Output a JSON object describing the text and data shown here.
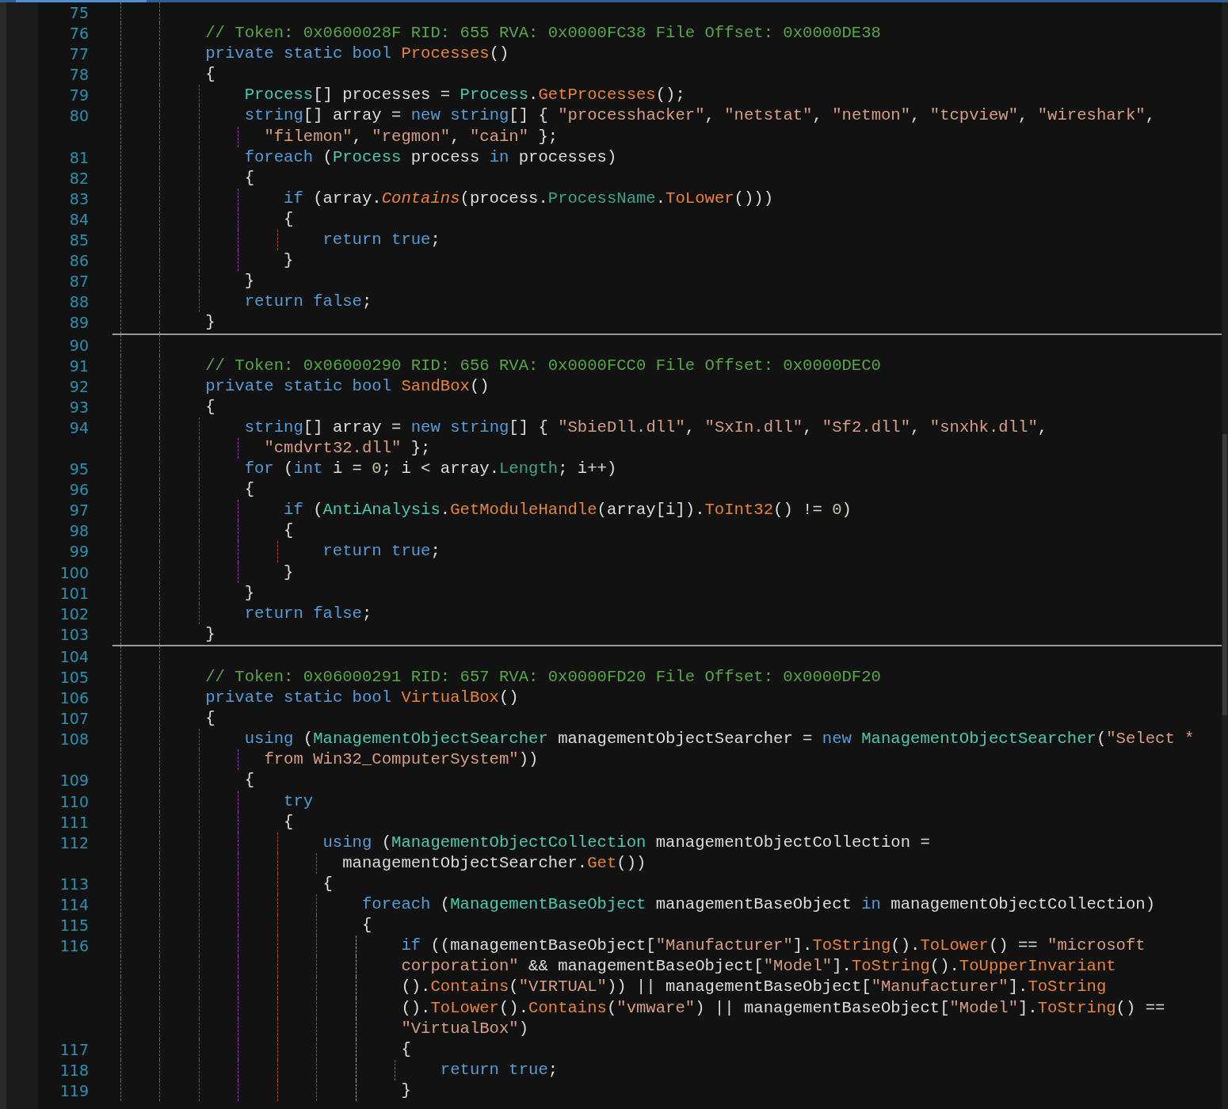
{
  "editor": {
    "blocks": [
      {
        "rows": [
          {
            "number": "75"
          },
          {
            "number": "76",
            "tokens": [
              {
                "kind": "comment",
                "text": "        // Token: 0x0600028F RID: 655 RVA: 0x0000FC38 File Offset: 0x0000DE38"
              }
            ]
          },
          {
            "number": "77",
            "tokens": [
              {
                "kind": "keyword",
                "text": "        private static bool "
              },
              {
                "kind": "method",
                "text": "Processes"
              },
              {
                "kind": "plain",
                "text": "()"
              }
            ]
          },
          {
            "number": "78",
            "tokens": [
              {
                "kind": "plain",
                "text": "        {"
              }
            ]
          },
          {
            "number": "79",
            "tokens": [
              {
                "kind": "type",
                "text": "            Process"
              },
              {
                "kind": "plain",
                "text": "[] processes = "
              },
              {
                "kind": "type",
                "text": "Process"
              },
              {
                "kind": "plain",
                "text": "."
              },
              {
                "kind": "method",
                "text": "GetProcesses"
              },
              {
                "kind": "plain",
                "text": "();"
              }
            ]
          },
          {
            "number": "80",
            "tokens": [
              {
                "kind": "keyword",
                "text": "            string"
              },
              {
                "kind": "plain",
                "text": "[] array = "
              },
              {
                "kind": "keyword",
                "text": "new string"
              },
              {
                "kind": "plain",
                "text": "[] { "
              },
              {
                "kind": "string",
                "text": "\"processhacker\""
              },
              {
                "kind": "plain",
                "text": ", "
              },
              {
                "kind": "string",
                "text": "\"netstat\""
              },
              {
                "kind": "plain",
                "text": ", "
              },
              {
                "kind": "string",
                "text": "\"netmon\""
              },
              {
                "kind": "plain",
                "text": ", "
              },
              {
                "kind": "string",
                "text": "\"tcpview\""
              },
              {
                "kind": "plain",
                "text": ", "
              },
              {
                "kind": "string",
                "text": "\"wireshark\""
              },
              {
                "kind": "plain",
                "text": ","
              }
            ]
          },
          {
            "tokens": [
              {
                "kind": "string",
                "text": "              \"filemon\""
              },
              {
                "kind": "plain",
                "text": ", "
              },
              {
                "kind": "string",
                "text": "\"regmon\""
              },
              {
                "kind": "plain",
                "text": ", "
              },
              {
                "kind": "string",
                "text": "\"cain\""
              },
              {
                "kind": "plain",
                "text": " };"
              }
            ]
          },
          {
            "number": "81",
            "tokens": [
              {
                "kind": "keyword",
                "text": "            foreach"
              },
              {
                "kind": "plain",
                "text": " ("
              },
              {
                "kind": "type",
                "text": "Process"
              },
              {
                "kind": "plain",
                "text": " process "
              },
              {
                "kind": "keyword",
                "text": "in"
              },
              {
                "kind": "plain",
                "text": " processes)"
              }
            ]
          },
          {
            "number": "82",
            "tokens": [
              {
                "kind": "plain",
                "text": "            {"
              }
            ]
          },
          {
            "number": "83",
            "tokens": [
              {
                "kind": "keyword",
                "text": "                if"
              },
              {
                "kind": "plain",
                "text": " (array."
              },
              {
                "kind": "extension",
                "text": "Contains"
              },
              {
                "kind": "plain",
                "text": "(process."
              },
              {
                "kind": "property",
                "text": "ProcessName"
              },
              {
                "kind": "plain",
                "text": "."
              },
              {
                "kind": "method",
                "text": "ToLower"
              },
              {
                "kind": "plain",
                "text": "()))"
              }
            ]
          },
          {
            "number": "84",
            "tokens": [
              {
                "kind": "plain",
                "text": "                {"
              }
            ]
          },
          {
            "number": "85",
            "tokens": [
              {
                "kind": "keyword",
                "text": "                    return true"
              },
              {
                "kind": "plain",
                "text": ";"
              }
            ]
          },
          {
            "number": "86",
            "tokens": [
              {
                "kind": "plain",
                "text": "                }"
              }
            ]
          },
          {
            "number": "87",
            "tokens": [
              {
                "kind": "plain",
                "text": "            }"
              }
            ]
          },
          {
            "number": "88",
            "tokens": [
              {
                "kind": "keyword",
                "text": "            return false"
              },
              {
                "kind": "plain",
                "text": ";"
              }
            ]
          },
          {
            "number": "89",
            "tokens": [
              {
                "kind": "plain",
                "text": "        }"
              }
            ]
          }
        ]
      },
      {
        "rows": [
          {
            "number": "90"
          },
          {
            "number": "91",
            "tokens": [
              {
                "kind": "comment",
                "text": "        // Token: 0x06000290 RID: 656 RVA: 0x0000FCC0 File Offset: 0x0000DEC0"
              }
            ]
          },
          {
            "number": "92",
            "tokens": [
              {
                "kind": "keyword",
                "text": "        private static bool "
              },
              {
                "kind": "method",
                "text": "SandBox"
              },
              {
                "kind": "plain",
                "text": "()"
              }
            ]
          },
          {
            "number": "93",
            "tokens": [
              {
                "kind": "plain",
                "text": "        {"
              }
            ]
          },
          {
            "number": "94",
            "tokens": [
              {
                "kind": "keyword",
                "text": "            string"
              },
              {
                "kind": "plain",
                "text": "[] array = "
              },
              {
                "kind": "keyword",
                "text": "new string"
              },
              {
                "kind": "plain",
                "text": "[] { "
              },
              {
                "kind": "string",
                "text": "\"SbieDll.dll\""
              },
              {
                "kind": "plain",
                "text": ", "
              },
              {
                "kind": "string",
                "text": "\"SxIn.dll\""
              },
              {
                "kind": "plain",
                "text": ", "
              },
              {
                "kind": "string",
                "text": "\"Sf2.dll\""
              },
              {
                "kind": "plain",
                "text": ", "
              },
              {
                "kind": "string",
                "text": "\"snxhk.dll\""
              },
              {
                "kind": "plain",
                "text": ","
              }
            ]
          },
          {
            "tokens": [
              {
                "kind": "string",
                "text": "              \"cmdvrt32.dll\""
              },
              {
                "kind": "plain",
                "text": " };"
              }
            ]
          },
          {
            "number": "95",
            "tokens": [
              {
                "kind": "keyword",
                "text": "            for"
              },
              {
                "kind": "plain",
                "text": " ("
              },
              {
                "kind": "keyword",
                "text": "int"
              },
              {
                "kind": "plain",
                "text": " i = "
              },
              {
                "kind": "number",
                "text": "0"
              },
              {
                "kind": "plain",
                "text": "; i < array."
              },
              {
                "kind": "property",
                "text": "Length"
              },
              {
                "kind": "plain",
                "text": "; i++)"
              }
            ]
          },
          {
            "number": "96",
            "tokens": [
              {
                "kind": "plain",
                "text": "            {"
              }
            ]
          },
          {
            "number": "97",
            "tokens": [
              {
                "kind": "keyword",
                "text": "                if"
              },
              {
                "kind": "plain",
                "text": " ("
              },
              {
                "kind": "type",
                "text": "AntiAnalysis"
              },
              {
                "kind": "plain",
                "text": "."
              },
              {
                "kind": "method",
                "text": "GetModuleHandle"
              },
              {
                "kind": "plain",
                "text": "(array[i])."
              },
              {
                "kind": "method",
                "text": "ToInt32"
              },
              {
                "kind": "plain",
                "text": "() != "
              },
              {
                "kind": "number",
                "text": "0"
              },
              {
                "kind": "plain",
                "text": ")"
              }
            ]
          },
          {
            "number": "98",
            "tokens": [
              {
                "kind": "plain",
                "text": "                {"
              }
            ]
          },
          {
            "number": "99",
            "tokens": [
              {
                "kind": "keyword",
                "text": "                    return true"
              },
              {
                "kind": "plain",
                "text": ";"
              }
            ]
          },
          {
            "number": "100",
            "tokens": [
              {
                "kind": "plain",
                "text": "                }"
              }
            ]
          },
          {
            "number": "101",
            "tokens": [
              {
                "kind": "plain",
                "text": "            }"
              }
            ]
          },
          {
            "number": "102",
            "tokens": [
              {
                "kind": "keyword",
                "text": "            return false"
              },
              {
                "kind": "plain",
                "text": ";"
              }
            ]
          },
          {
            "number": "103",
            "tokens": [
              {
                "kind": "plain",
                "text": "        }"
              }
            ]
          }
        ]
      },
      {
        "rows": [
          {
            "number": "104"
          },
          {
            "number": "105",
            "tokens": [
              {
                "kind": "comment",
                "text": "        // Token: 0x06000291 RID: 657 RVA: 0x0000FD20 File Offset: 0x0000DF20"
              }
            ]
          },
          {
            "number": "106",
            "tokens": [
              {
                "kind": "keyword",
                "text": "        private static bool "
              },
              {
                "kind": "method",
                "text": "VirtualBox"
              },
              {
                "kind": "plain",
                "text": "()"
              }
            ]
          },
          {
            "number": "107",
            "tokens": [
              {
                "kind": "plain",
                "text": "        {"
              }
            ]
          },
          {
            "number": "108",
            "tokens": [
              {
                "kind": "keyword",
                "text": "            using"
              },
              {
                "kind": "plain",
                "text": " ("
              },
              {
                "kind": "type",
                "text": "ManagementObjectSearcher"
              },
              {
                "kind": "plain",
                "text": " managementObjectSearcher = "
              },
              {
                "kind": "keyword",
                "text": "new "
              },
              {
                "kind": "type",
                "text": "ManagementObjectSearcher"
              },
              {
                "kind": "plain",
                "text": "("
              },
              {
                "kind": "string",
                "text": "\"Select *"
              }
            ]
          },
          {
            "tokens": [
              {
                "kind": "string",
                "text": "              from Win32_ComputerSystem\""
              },
              {
                "kind": "plain",
                "text": "))"
              }
            ]
          },
          {
            "number": "109",
            "tokens": [
              {
                "kind": "plain",
                "text": "            {"
              }
            ]
          },
          {
            "number": "110",
            "tokens": [
              {
                "kind": "keyword",
                "text": "                try"
              }
            ]
          },
          {
            "number": "111",
            "tokens": [
              {
                "kind": "plain",
                "text": "                {"
              }
            ]
          },
          {
            "number": "112",
            "tokens": [
              {
                "kind": "keyword",
                "text": "                    using"
              },
              {
                "kind": "plain",
                "text": " ("
              },
              {
                "kind": "type",
                "text": "ManagementObjectCollection"
              },
              {
                "kind": "plain",
                "text": " managementObjectCollection ="
              }
            ]
          },
          {
            "tokens": [
              {
                "kind": "plain",
                "text": "                      managementObjectSearcher."
              },
              {
                "kind": "method",
                "text": "Get"
              },
              {
                "kind": "plain",
                "text": "())"
              }
            ]
          },
          {
            "number": "113",
            "tokens": [
              {
                "kind": "plain",
                "text": "                    {"
              }
            ]
          },
          {
            "number": "114",
            "tokens": [
              {
                "kind": "keyword",
                "text": "                        foreach"
              },
              {
                "kind": "plain",
                "text": " ("
              },
              {
                "kind": "type",
                "text": "ManagementBaseObject"
              },
              {
                "kind": "plain",
                "text": " managementBaseObject "
              },
              {
                "kind": "keyword",
                "text": "in"
              },
              {
                "kind": "plain",
                "text": " managementObjectCollection)"
              }
            ]
          },
          {
            "number": "115",
            "tokens": [
              {
                "kind": "plain",
                "text": "                        {"
              }
            ]
          },
          {
            "number": "116",
            "tokens": [
              {
                "kind": "keyword",
                "text": "                            if"
              },
              {
                "kind": "plain",
                "text": " ((managementBaseObject["
              },
              {
                "kind": "string",
                "text": "\"Manufacturer\""
              },
              {
                "kind": "plain",
                "text": "]."
              },
              {
                "kind": "method",
                "text": "ToString"
              },
              {
                "kind": "plain",
                "text": "()."
              },
              {
                "kind": "method",
                "text": "ToLower"
              },
              {
                "kind": "plain",
                "text": "() == "
              },
              {
                "kind": "string",
                "text": "\"microsoft"
              }
            ]
          },
          {
            "tokens": [
              {
                "kind": "string",
                "text": "                            corporation\""
              },
              {
                "kind": "plain",
                "text": " && managementBaseObject["
              },
              {
                "kind": "string",
                "text": "\"Model\""
              },
              {
                "kind": "plain",
                "text": "]."
              },
              {
                "kind": "method",
                "text": "ToString"
              },
              {
                "kind": "plain",
                "text": "()."
              },
              {
                "kind": "method",
                "text": "ToUpperInvariant"
              }
            ]
          },
          {
            "tokens": [
              {
                "kind": "plain",
                "text": "                            ()."
              },
              {
                "kind": "method",
                "text": "Contains"
              },
              {
                "kind": "plain",
                "text": "("
              },
              {
                "kind": "string",
                "text": "\"VIRTUAL\""
              },
              {
                "kind": "plain",
                "text": ")) || managementBaseObject["
              },
              {
                "kind": "string",
                "text": "\"Manufacturer\""
              },
              {
                "kind": "plain",
                "text": "]."
              },
              {
                "kind": "method",
                "text": "ToString"
              }
            ]
          },
          {
            "tokens": [
              {
                "kind": "plain",
                "text": "                            ()."
              },
              {
                "kind": "method",
                "text": "ToLower"
              },
              {
                "kind": "plain",
                "text": "()."
              },
              {
                "kind": "method",
                "text": "Contains"
              },
              {
                "kind": "plain",
                "text": "("
              },
              {
                "kind": "string",
                "text": "\"vmware\""
              },
              {
                "kind": "plain",
                "text": ") || managementBaseObject["
              },
              {
                "kind": "string",
                "text": "\"Model\""
              },
              {
                "kind": "plain",
                "text": "]."
              },
              {
                "kind": "method",
                "text": "ToString"
              },
              {
                "kind": "plain",
                "text": "() =="
              }
            ]
          },
          {
            "tokens": [
              {
                "kind": "string",
                "text": "                            \"VirtualBox\""
              },
              {
                "kind": "plain",
                "text": ")"
              }
            ]
          },
          {
            "number": "117",
            "tokens": [
              {
                "kind": "plain",
                "text": "                            {"
              }
            ]
          },
          {
            "number": "118",
            "tokens": [
              {
                "kind": "keyword",
                "text": "                                return true"
              },
              {
                "kind": "plain",
                "text": ";"
              }
            ]
          },
          {
            "number": "119",
            "tokens": [
              {
                "kind": "plain",
                "text": "                            }"
              }
            ]
          }
        ]
      }
    ]
  }
}
